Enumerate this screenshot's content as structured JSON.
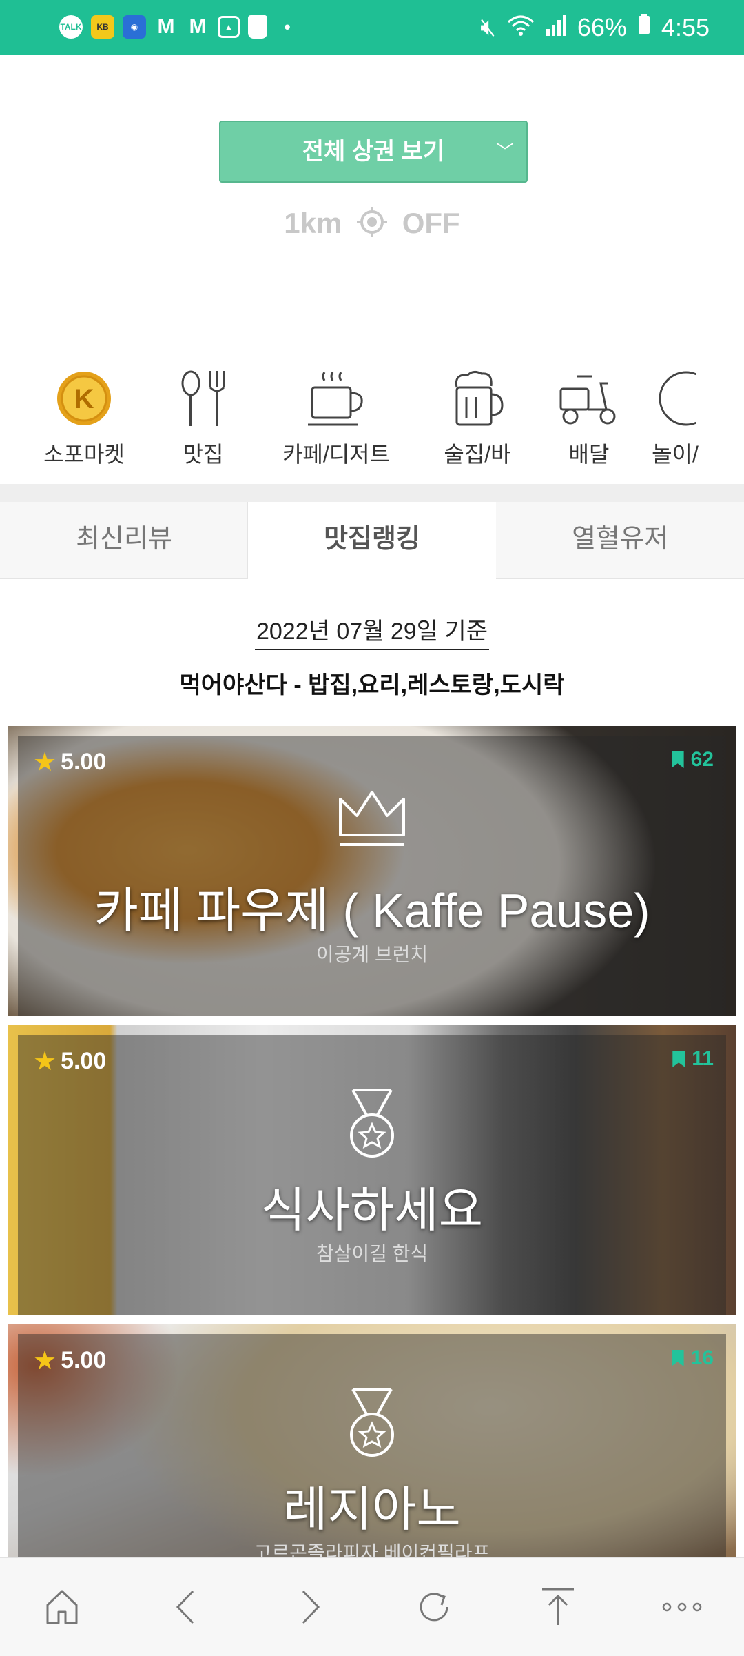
{
  "status_bar": {
    "notification_icons": [
      "talk-icon",
      "kb-icon",
      "app-icon",
      "gmail-icon",
      "gmail-icon",
      "gallery-icon",
      "shopping-bag-icon",
      "dot-icon"
    ],
    "battery": "66%",
    "time": "4:55"
  },
  "header": {
    "area_dropdown_label": "전체 상권 보기",
    "distance_label": "1km",
    "location_toggle_label": "OFF"
  },
  "categories": [
    {
      "label": "소포마켓",
      "icon": "coin-k-icon"
    },
    {
      "label": "맛집",
      "icon": "spoon-fork-icon"
    },
    {
      "label": "카페/디저트",
      "icon": "coffee-cup-icon"
    },
    {
      "label": "술집/바",
      "icon": "beer-mug-icon"
    },
    {
      "label": "배달",
      "icon": "scooter-icon"
    },
    {
      "label": "놀이/",
      "icon": "play-icon"
    }
  ],
  "tabs": [
    {
      "label": "최신리뷰"
    },
    {
      "label": "맛집랭킹",
      "active": true
    },
    {
      "label": "열혈유저"
    }
  ],
  "ranking": {
    "date_label": "2022년 07월 29일 기준",
    "category_title": "먹어야산다 - 밥집,요리,레스토랑,도시락",
    "items": [
      {
        "rating": "5.00",
        "bookmarks": "62",
        "name": "카페 파우제 ( Kaffe Pause)",
        "subtitle": "이공계 브런치",
        "emblem": "crown-icon"
      },
      {
        "rating": "5.00",
        "bookmarks": "11",
        "name": "식사하세요",
        "subtitle": "참살이길 한식",
        "emblem": "medal-icon"
      },
      {
        "rating": "5.00",
        "bookmarks": "16",
        "name": "레지아노",
        "subtitle": "고르곤졸라피자 베이컨필라프",
        "emblem": "medal-icon"
      }
    ]
  },
  "bottom_nav": [
    "home-icon",
    "back-icon",
    "forward-icon",
    "reload-icon",
    "scroll-top-icon",
    "more-icon"
  ],
  "colors": {
    "accent": "#1fbf94",
    "dropdown": "#6fcfa6",
    "bookmark": "#23c39b",
    "star": "#f5c518"
  }
}
